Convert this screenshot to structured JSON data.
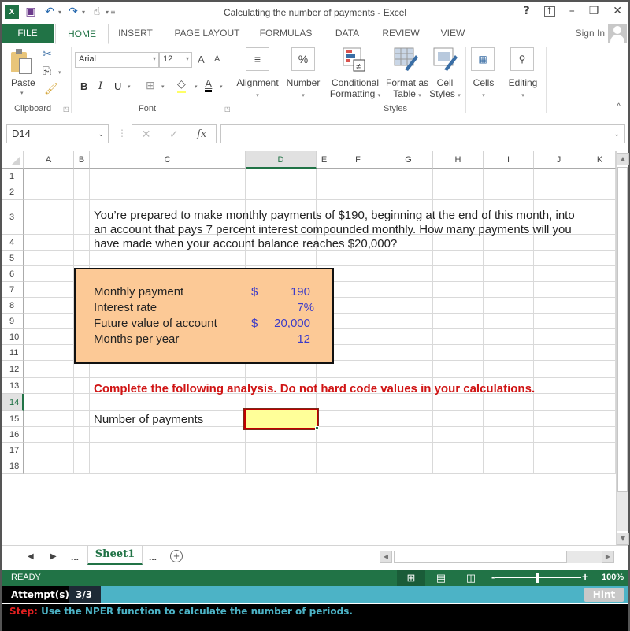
{
  "window": {
    "title": "Calculating the number of payments - Excel",
    "controls": [
      "?",
      "ribbon-display",
      "minimize",
      "restore",
      "close"
    ]
  },
  "qat": {
    "app_icon": "excel-icon",
    "items": [
      "save-icon",
      "undo-icon",
      "redo-icon",
      "touch-mode-icon",
      "customize-icon"
    ]
  },
  "tabs": [
    {
      "label": "FILE"
    },
    {
      "label": "HOME",
      "active": true
    },
    {
      "label": "INSERT"
    },
    {
      "label": "PAGE LAYOUT"
    },
    {
      "label": "FORMULAS"
    },
    {
      "label": "DATA"
    },
    {
      "label": "REVIEW"
    },
    {
      "label": "VIEW"
    }
  ],
  "account": {
    "sign_in": "Sign In"
  },
  "ribbon": {
    "clipboard": {
      "paste": "Paste",
      "group": "Clipboard"
    },
    "font": {
      "name": "Arial",
      "size": "12",
      "bold": "B",
      "italic": "I",
      "underline": "U",
      "grow": "A",
      "shrink": "A",
      "font_color": "A",
      "group": "Font"
    },
    "alignment": {
      "label": "Alignment",
      "icon": "≡"
    },
    "number": {
      "label": "Number",
      "icon": "%"
    },
    "styles": {
      "conditional_1": "Conditional",
      "conditional_2": "Formatting",
      "table_1": "Format as",
      "table_2": "Table",
      "cell_1": "Cell",
      "cell_2": "Styles",
      "group": "Styles"
    },
    "cells": {
      "label": "Cells"
    },
    "editing": {
      "label": "Editing"
    }
  },
  "formula_bar": {
    "name_box": "D14",
    "cancel": "✕",
    "enter": "✓",
    "fx": "fx",
    "formula": ""
  },
  "sheet": {
    "columns": [
      "A",
      "B",
      "C",
      "D",
      "E",
      "F",
      "G",
      "H",
      "I",
      "J",
      "K"
    ],
    "selected_column": "D",
    "rows": [
      "1",
      "2",
      "3",
      "4",
      "5",
      "6",
      "7",
      "8",
      "9",
      "10",
      "11",
      "12",
      "13",
      "14",
      "15",
      "16",
      "17",
      "18"
    ],
    "selected_row": "14",
    "problem": "You’re prepared to make monthly payments of $190, beginning at the end of this month, into an account that pays 7 percent interest compounded monthly. How many payments will you have made when your account balance reaches $20,000?",
    "inputs": [
      {
        "label": "Monthly payment",
        "currency": "$",
        "value": "190"
      },
      {
        "label": "Interest rate",
        "currency": "",
        "value": "7%"
      },
      {
        "label": "Future value of account",
        "currency": "$",
        "value": "20,000"
      },
      {
        "label": "Months per year",
        "currency": "",
        "value": "12"
      }
    ],
    "instruction": "Complete the following analysis. Do not hard code values in your calculations.",
    "output_label": "Number of payments",
    "output_value": ""
  },
  "sheet_tabs": {
    "active": "Sheet1",
    "ellipsis": "..."
  },
  "status": {
    "text": "READY",
    "zoom": "100%",
    "zoom_fraction": 0.5
  },
  "assessment": {
    "attempts_label": "Attempt(s)",
    "attempts_value": "3/3",
    "hint": "Hint",
    "step_label": "Step:",
    "step_text": "Use the NPER function to calculate the number of periods."
  },
  "colors": {
    "excel_green": "#217346",
    "input_fill": "#fcc996",
    "answer_fill": "#ffff99",
    "instruction_red": "#d01414",
    "value_blue": "#3b3bc8",
    "attempt_teal": "#4cb3c6"
  }
}
